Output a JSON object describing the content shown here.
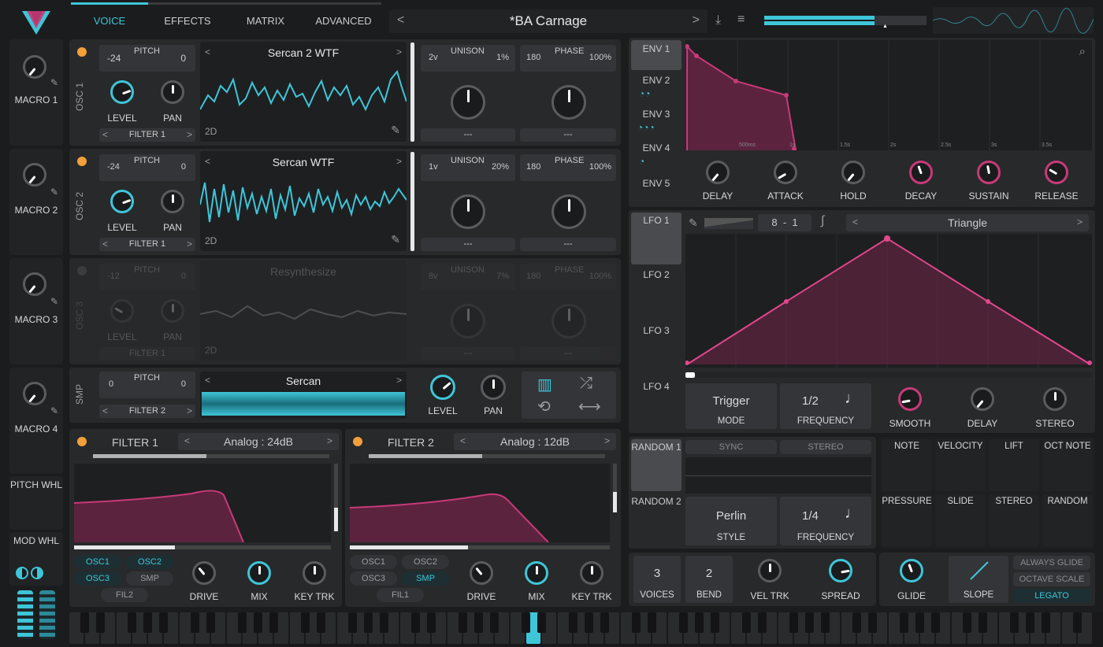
{
  "nav": {
    "tabs": [
      "VOICE",
      "EFFECTS",
      "MATRIX",
      "ADVANCED"
    ],
    "preset": "*BA Carnage"
  },
  "macros": [
    "MACRO 1",
    "MACRO 2",
    "MACRO 3",
    "MACRO 4",
    "PITCH WHL",
    "MOD WHL"
  ],
  "osc1": {
    "label": "OSC 1",
    "pitch_lo": "-24",
    "pitch_title": "PITCH",
    "pitch_hi": "0",
    "wave": "Sercan 2 WTF",
    "mode": "2D",
    "level": "LEVEL",
    "pan": "PAN",
    "filter": "FILTER 1",
    "unison_v": "2v",
    "unison": "UNISON",
    "unison_pct": "1%",
    "phase_v": "180",
    "phase": "PHASE",
    "phase_pct": "100%",
    "dash": "---"
  },
  "osc2": {
    "label": "OSC 2",
    "pitch_lo": "-24",
    "pitch_title": "PITCH",
    "pitch_hi": "0",
    "wave": "Sercan WTF",
    "mode": "2D",
    "level": "LEVEL",
    "pan": "PAN",
    "filter": "FILTER 1",
    "unison_v": "1v",
    "unison": "UNISON",
    "unison_pct": "20%",
    "phase_v": "180",
    "phase": "PHASE",
    "phase_pct": "100%",
    "dash": "---"
  },
  "osc3": {
    "label": "OSC 3",
    "pitch_lo": "-12",
    "pitch_title": "PITCH",
    "pitch_hi": "0",
    "wave": "Resynthesize",
    "mode": "2D",
    "level": "LEVEL",
    "pan": "PAN",
    "filter": "FILTER 1",
    "unison_v": "8v",
    "unison": "UNISON",
    "unison_pct": "7%",
    "phase_v": "180",
    "phase": "PHASE",
    "phase_pct": "100%",
    "dash": "---"
  },
  "smp": {
    "label": "SMP",
    "pitch_lo": "0",
    "pitch_title": "PITCH",
    "pitch_hi": "0",
    "sample": "Sercan",
    "filter": "FILTER 2",
    "level": "LEVEL",
    "pan": "PAN"
  },
  "filter1": {
    "title": "FILTER 1",
    "model": "Analog : 24dB",
    "drive": "DRIVE",
    "mix": "MIX",
    "keytrk": "KEY TRK",
    "routes": [
      "OSC1",
      "OSC2",
      "OSC3",
      "SMP",
      "FIL2"
    ]
  },
  "filter2": {
    "title": "FILTER 2",
    "model": "Analog : 12dB",
    "drive": "DRIVE",
    "mix": "MIX",
    "keytrk": "KEY TRK",
    "routes": [
      "OSC1",
      "OSC2",
      "OSC3",
      "SMP",
      "FIL1"
    ]
  },
  "env": {
    "tabs": [
      "ENV 1",
      "ENV 2",
      "ENV 3",
      "ENV 4",
      "ENV 5"
    ],
    "times": [
      "500ms",
      "1s",
      "1.5s",
      "2s",
      "2.5s",
      "3s",
      "3.5s"
    ],
    "knobs": [
      "DELAY",
      "ATTACK",
      "HOLD",
      "DECAY",
      "SUSTAIN",
      "RELEASE"
    ]
  },
  "lfo": {
    "tabs": [
      "LFO 1",
      "LFO 2",
      "LFO 3",
      "LFO 4"
    ],
    "rate": "8  -  1",
    "shape": "Triangle",
    "mode_val": "Trigger",
    "mode": "MODE",
    "freq_val": "1/2",
    "freq": "FREQUENCY",
    "knobs": [
      "SMOOTH",
      "DELAY",
      "STEREO"
    ]
  },
  "random": {
    "tabs": [
      "RANDOM 1",
      "RANDOM 2"
    ],
    "sync": "SYNC",
    "stereo": "STEREO",
    "style_val": "Perlin",
    "style": "STYLE",
    "freq_val": "1/4",
    "freq": "FREQUENCY"
  },
  "mods": [
    "NOTE",
    "VELOCITY",
    "LIFT",
    "OCT NOTE",
    "PRESSURE",
    "SLIDE",
    "STEREO",
    "RANDOM"
  ],
  "voice": {
    "voices_val": "3",
    "voices": "VOICES",
    "bend_val": "2",
    "bend": "BEND",
    "veltrk": "VEL TRK",
    "spread": "SPREAD",
    "glide": "GLIDE",
    "slope": "SLOPE",
    "opts": [
      "ALWAYS GLIDE",
      "OCTAVE SCALE",
      "LEGATO"
    ]
  }
}
